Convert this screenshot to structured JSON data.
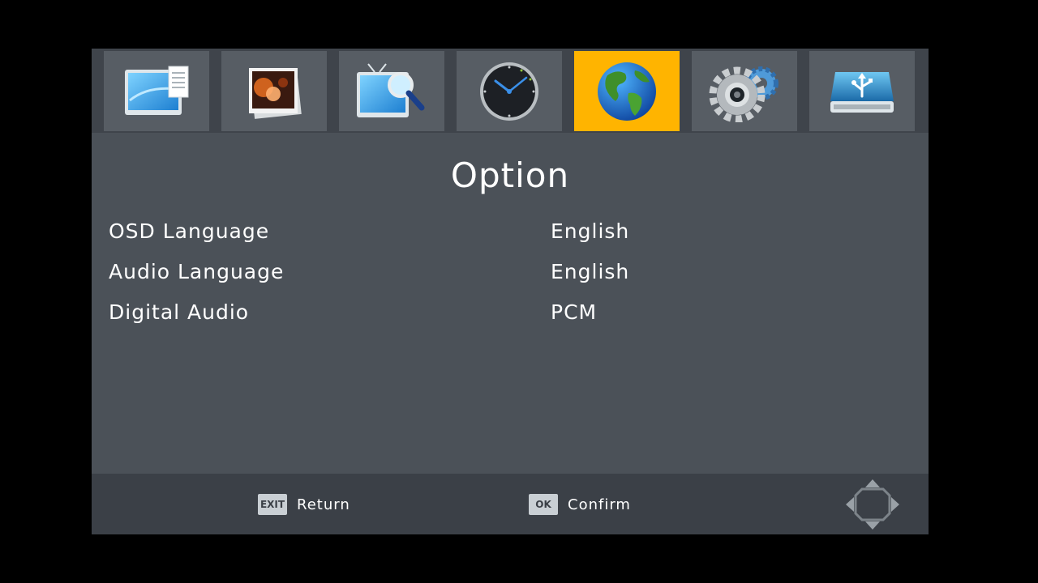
{
  "tabs": [
    {
      "icon": "monitor-document-icon",
      "active": false
    },
    {
      "icon": "photo-icon",
      "active": false
    },
    {
      "icon": "tv-search-icon",
      "active": false
    },
    {
      "icon": "clock-icon",
      "active": false
    },
    {
      "icon": "globe-icon",
      "active": true
    },
    {
      "icon": "gear-icon",
      "active": false
    },
    {
      "icon": "usb-drive-icon",
      "active": false
    }
  ],
  "page": {
    "title": "Option"
  },
  "options": [
    {
      "label": "OSD Language",
      "value": "English"
    },
    {
      "label": "Audio Language",
      "value": "English"
    },
    {
      "label": "Digital Audio",
      "value": "PCM"
    }
  ],
  "footer": {
    "exit_key": "EXIT",
    "exit_label": "Return",
    "ok_key": "OK",
    "ok_label": "Confirm",
    "nav_icon": "dpad-arrows-icon"
  },
  "colors": {
    "active_tab": "#ffb400",
    "panel": "#4b5158",
    "tabbar": "#3f444b",
    "footer": "#3b4047",
    "text": "#ffffff"
  }
}
